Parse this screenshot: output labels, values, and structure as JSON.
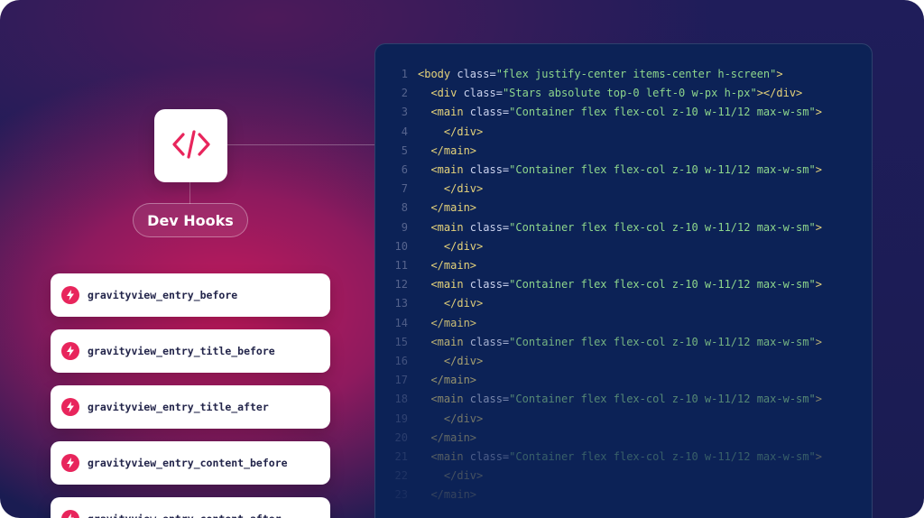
{
  "devhooks": {
    "label": "Dev Hooks",
    "icon": "code-icon",
    "hooks": [
      {
        "name": "gravityview_entry_before",
        "icon": "bolt-icon"
      },
      {
        "name": "gravityview_entry_title_before",
        "icon": "bolt-icon"
      },
      {
        "name": "gravityview_entry_title_after",
        "icon": "bolt-icon"
      },
      {
        "name": "gravityview_entry_content_before",
        "icon": "bolt-icon"
      },
      {
        "name": "gravityview_entry_content_after",
        "icon": "bolt-icon"
      }
    ]
  },
  "code": {
    "lines": [
      {
        "num": "1",
        "indent": "",
        "tag_open": "<body",
        "attr": " class=",
        "value": "\"flex justify-center items-center h-screen\"",
        "tag_close": ">"
      },
      {
        "num": "2",
        "indent": "  ",
        "tag_open": "<div",
        "attr": " class=",
        "value": "\"Stars absolute top-0 left-0 w-px h-px\"",
        "tag_close": "></div>"
      },
      {
        "num": "3",
        "indent": "  ",
        "tag_open": "<main",
        "attr": " class=",
        "value": "\"Container flex flex-col z-10 w-11/12 max-w-sm\"",
        "tag_close": ">"
      },
      {
        "num": "4",
        "indent": "    ",
        "tag_open": "</div>",
        "attr": "",
        "value": "",
        "tag_close": ""
      },
      {
        "num": "5",
        "indent": "  ",
        "tag_open": "</main>",
        "attr": "",
        "value": "",
        "tag_close": ""
      },
      {
        "num": "6",
        "indent": "  ",
        "tag_open": "<main",
        "attr": " class=",
        "value": "\"Container flex flex-col z-10 w-11/12 max-w-sm\"",
        "tag_close": ">"
      },
      {
        "num": "7",
        "indent": "    ",
        "tag_open": "</div>",
        "attr": "",
        "value": "",
        "tag_close": ""
      },
      {
        "num": "8",
        "indent": "  ",
        "tag_open": "</main>",
        "attr": "",
        "value": "",
        "tag_close": ""
      },
      {
        "num": "9",
        "indent": "  ",
        "tag_open": "<main",
        "attr": " class=",
        "value": "\"Container flex flex-col z-10 w-11/12 max-w-sm\"",
        "tag_close": ">"
      },
      {
        "num": "10",
        "indent": "    ",
        "tag_open": "</div>",
        "attr": "",
        "value": "",
        "tag_close": ""
      },
      {
        "num": "11",
        "indent": "  ",
        "tag_open": "</main>",
        "attr": "",
        "value": "",
        "tag_close": ""
      },
      {
        "num": "12",
        "indent": "  ",
        "tag_open": "<main",
        "attr": " class=",
        "value": "\"Container flex flex-col z-10 w-11/12 max-w-sm\"",
        "tag_close": ">"
      },
      {
        "num": "13",
        "indent": "    ",
        "tag_open": "</div>",
        "attr": "",
        "value": "",
        "tag_close": ""
      },
      {
        "num": "14",
        "indent": "  ",
        "tag_open": "</main>",
        "attr": "",
        "value": "",
        "tag_close": ""
      },
      {
        "num": "15",
        "indent": "  ",
        "tag_open": "<main",
        "attr": " class=",
        "value": "\"Container flex flex-col z-10 w-11/12 max-w-sm\"",
        "tag_close": ">"
      },
      {
        "num": "16",
        "indent": "    ",
        "tag_open": "</div>",
        "attr": "",
        "value": "",
        "tag_close": ""
      },
      {
        "num": "17",
        "indent": "  ",
        "tag_open": "</main>",
        "attr": "",
        "value": "",
        "tag_close": ""
      },
      {
        "num": "18",
        "indent": "  ",
        "tag_open": "<main",
        "attr": " class=",
        "value": "\"Container flex flex-col z-10 w-11/12 max-w-sm\"",
        "tag_close": ">"
      },
      {
        "num": "19",
        "indent": "    ",
        "tag_open": "</div>",
        "attr": "",
        "value": "",
        "tag_close": ""
      },
      {
        "num": "20",
        "indent": "  ",
        "tag_open": "</main>",
        "attr": "",
        "value": "",
        "tag_close": ""
      },
      {
        "num": "21",
        "indent": "  ",
        "tag_open": "<main",
        "attr": " class=",
        "value": "\"Container flex flex-col z-10 w-11/12 max-w-sm\"",
        "tag_close": ">"
      },
      {
        "num": "22",
        "indent": "    ",
        "tag_open": "</div>",
        "attr": "",
        "value": "",
        "tag_close": ""
      },
      {
        "num": "23",
        "indent": "  ",
        "tag_open": "</main>",
        "attr": "",
        "value": "",
        "tag_close": ""
      }
    ]
  },
  "colors": {
    "accent": "#e8255c",
    "code_bg": "#0c2256",
    "tag": "#e6d37a",
    "string": "#8ed68c",
    "line_number": "#56648e"
  }
}
